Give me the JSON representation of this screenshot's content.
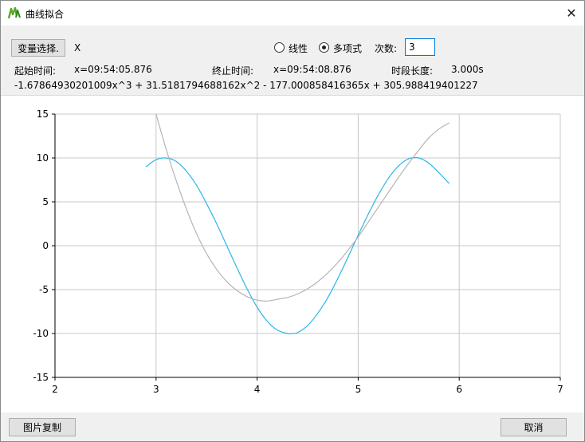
{
  "window": {
    "title": "曲线拟合",
    "close_glyph": "✕"
  },
  "toolbar": {
    "variable_button": "变量选择.",
    "variable_value": "X",
    "radio_linear": "线性",
    "radio_poly": "多项式",
    "selected_mode": "poly",
    "degree_label": "次数:",
    "degree_value": "3",
    "start_label": "起始时间:",
    "start_value": "x=09:54:05.876",
    "end_label": "终止时间:",
    "end_value": "x=09:54:08.876",
    "duration_label": "时段长度:",
    "duration_value": "3.000s",
    "equation": "-1.67864930201009x^3 + 31.5181794688162x^2 - 177.000858416365x + 305.988419401227"
  },
  "footer": {
    "copy_button": "图片复制",
    "cancel_button": "取消"
  },
  "chart_data": {
    "type": "line",
    "xlim": [
      2,
      7
    ],
    "ylim": [
      -15,
      15
    ],
    "x_ticks": [
      "2",
      "3",
      "4",
      "5",
      "6",
      "7"
    ],
    "y_ticks": [
      "15",
      "10",
      "5",
      "0",
      "-5",
      "-10",
      "-15"
    ],
    "grid": true,
    "series": [
      {
        "color": "#29b6e6",
        "style": "curve",
        "x": [
          2.9,
          3.0,
          3.1,
          3.2,
          3.3,
          3.4,
          3.5,
          3.6,
          3.7,
          3.8,
          3.9,
          4.0,
          4.1,
          4.2,
          4.3,
          4.35,
          4.4,
          4.5,
          4.6,
          4.7,
          4.8,
          4.9,
          5.0,
          5.1,
          5.2,
          5.3,
          5.4,
          5.5,
          5.6,
          5.7,
          5.8,
          5.9
        ],
        "y": [
          9.0,
          9.8,
          10.0,
          9.6,
          8.5,
          6.9,
          4.8,
          2.5,
          0.0,
          -2.5,
          -4.9,
          -7.0,
          -8.6,
          -9.6,
          -10.0,
          -10.0,
          -9.9,
          -9.1,
          -7.7,
          -5.9,
          -3.7,
          -1.3,
          1.2,
          3.6,
          5.8,
          7.7,
          9.1,
          9.9,
          10.0,
          9.4,
          8.3,
          7.1
        ]
      },
      {
        "color": "#b4b4b4",
        "style": "curve",
        "x": [
          3.0,
          3.1,
          3.2,
          3.3,
          3.4,
          3.5,
          3.6,
          3.7,
          3.8,
          3.9,
          4.0,
          4.1,
          4.2,
          4.25,
          4.3,
          4.4,
          4.5,
          4.6,
          4.7,
          4.8,
          4.9,
          5.0,
          5.1,
          5.2,
          5.3,
          5.4,
          5.5,
          5.6,
          5.7,
          5.8,
          5.9
        ],
        "y": [
          15.0,
          11.0,
          7.4,
          4.2,
          1.4,
          -0.9,
          -2.7,
          -4.1,
          -5.1,
          -5.8,
          -6.2,
          -6.3,
          -6.1,
          -6.0,
          -5.9,
          -5.5,
          -4.9,
          -4.1,
          -3.1,
          -1.9,
          -0.5,
          1.0,
          2.7,
          4.4,
          6.1,
          7.8,
          9.4,
          10.9,
          12.3,
          13.3,
          14.0
        ]
      }
    ]
  },
  "colors": {
    "accent_focus": "#0078d7",
    "toolbar_bg": "#f0f0f0",
    "grid": "#c8c8c8"
  },
  "icons": {
    "app": "fit-curve-app-icon",
    "close": "close-icon"
  }
}
